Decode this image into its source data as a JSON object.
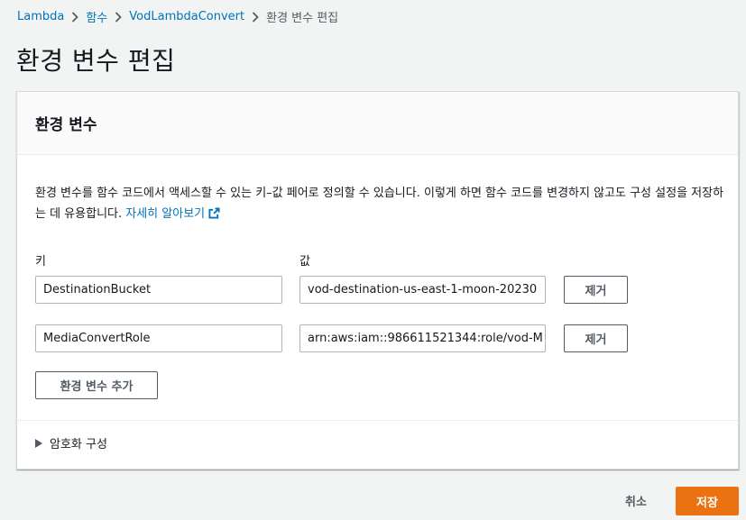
{
  "breadcrumb": {
    "items": [
      "Lambda",
      "함수",
      "VodLambdaConvert"
    ],
    "current": "환경 변수 편집"
  },
  "page_title": "환경 변수 편집",
  "panel": {
    "title": "환경 변수",
    "description": "환경 변수를 함수 코드에서 액세스할 수 있는 키–값 페어로 정의할 수 있습니다. 이렇게 하면 함수 코드를 변경하지 않고도 구성 설정을 저장하는 데 유용합니다.",
    "learn_more": "자세히 알아보기",
    "key_label": "키",
    "value_label": "값",
    "variables": [
      {
        "key": "DestinationBucket",
        "value": "vod-destination-us-east-1-moon-20230",
        "remove": "제거"
      },
      {
        "key": "MediaConvertRole",
        "value": "arn:aws:iam::986611521344:role/vod-M",
        "remove": "제거"
      }
    ],
    "add_button": "환경 변수 추가",
    "encryption_label": "암호화 구성"
  },
  "footer": {
    "cancel": "취소",
    "save": "저장"
  },
  "colors": {
    "link": "#0073bb",
    "primary": "#ec7211",
    "background": "#f2f3f3"
  },
  "icons": [
    "chevron-right-icon",
    "external-link-icon",
    "caret-right-icon"
  ]
}
